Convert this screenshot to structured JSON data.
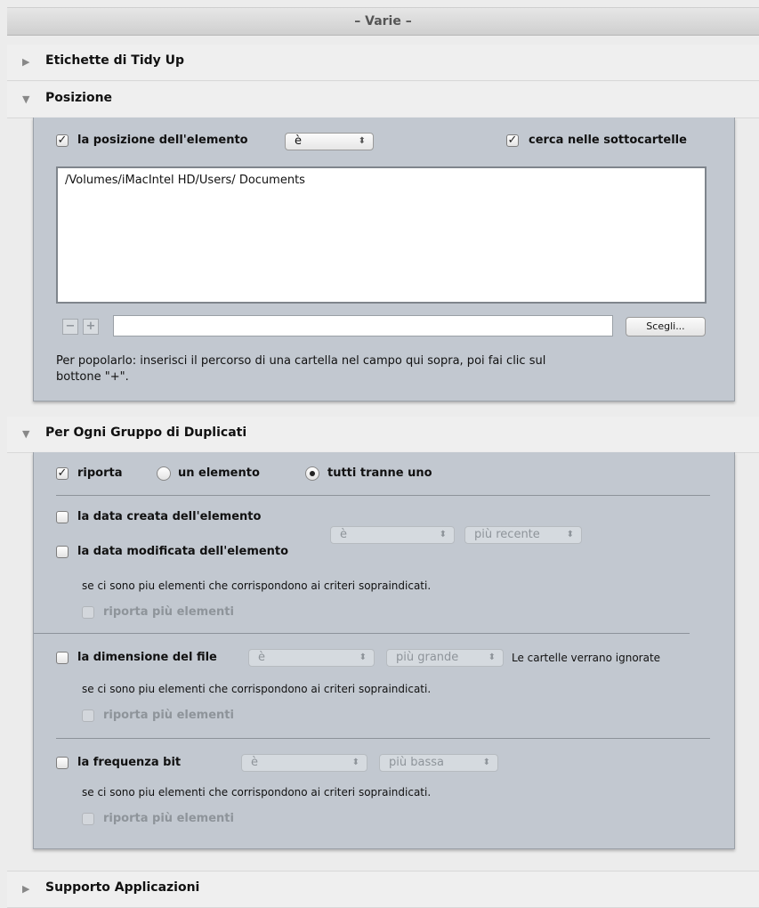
{
  "header": {
    "title": "– Varie –"
  },
  "sections": {
    "tidy_up_labels": "Etichette di Tidy Up",
    "position": "Posizione",
    "duplicates": "Per Ogni Gruppo di Duplicati",
    "app_support": "Supporto Applicazioni"
  },
  "position": {
    "item_position_label": "la posizione dell'elemento",
    "operator_value": "è",
    "search_subfolders_label": "cerca nelle sottocartelle",
    "paths": [
      "/Volumes/iMacIntel HD/Users/ Documents"
    ],
    "minus": "−",
    "plus": "+",
    "path_input_value": "",
    "choose_button": "Scegli...",
    "help_text_1": "Per popolarlo: inserisci il percorso di una cartella nel campo qui sopra, poi fai clic sul",
    "help_text_2": "bottone \"+\"."
  },
  "duplicates": {
    "report_label": "riporta",
    "radio_one": "un elemento",
    "radio_all_but_one": "tutti tranne uno",
    "created_date_label": "la data creata dell'elemento",
    "modified_date_label": "la data modificata dell'elemento",
    "date_operator": "è",
    "date_order": "più recente",
    "note": "se ci sono piu elementi che corrispondono ai criteri sopraindicati.",
    "report_more": "riporta più elementi",
    "file_size_label": "la dimensione del file",
    "size_operator": "è",
    "size_order": "più grande",
    "folders_ignored": "Le cartelle verrano ignorate",
    "bitrate_label": "la frequenza bit",
    "bitrate_operator": "è",
    "bitrate_order": "più bassa"
  }
}
